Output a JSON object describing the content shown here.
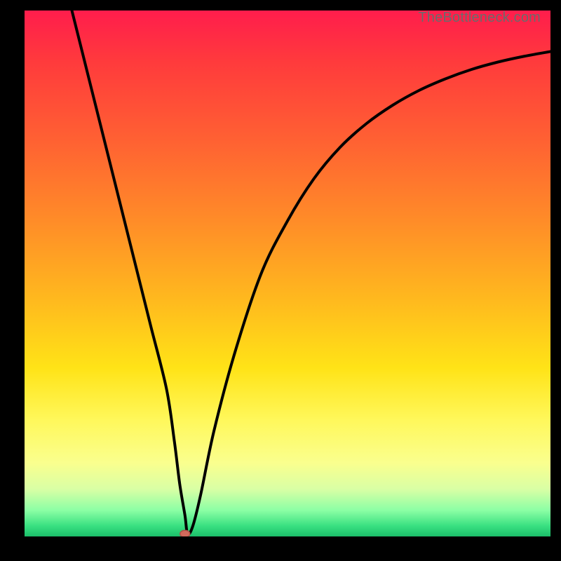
{
  "attribution": "TheBottleneck.com",
  "colors": {
    "frame": "#000000",
    "curve_stroke": "#000000",
    "marker_fill": "#d26a5c",
    "marker_stroke": "#b25048",
    "gradient_top": "#ff1d4c",
    "gradient_bottom": "#1bbf6a"
  },
  "chart_data": {
    "type": "line",
    "title": "",
    "xlabel": "",
    "ylabel": "",
    "xlim": [
      0,
      100
    ],
    "ylim": [
      0,
      100
    ],
    "x": [
      9,
      12,
      15,
      18,
      21,
      24,
      27,
      28.5,
      29.5,
      30.5,
      31,
      32,
      33.5,
      36,
      40,
      45,
      50,
      55,
      60,
      65,
      70,
      75,
      80,
      85,
      90,
      95,
      100
    ],
    "y": [
      100,
      88,
      76,
      64,
      52,
      40,
      28,
      18,
      10,
      4,
      0.5,
      2,
      8,
      20,
      35,
      50,
      60,
      68,
      74,
      78.5,
      82,
      84.8,
      87,
      88.8,
      90.2,
      91.3,
      92.2
    ],
    "annotations": [
      {
        "name": "min-marker",
        "x": 30.5,
        "y": 0.5
      }
    ]
  }
}
